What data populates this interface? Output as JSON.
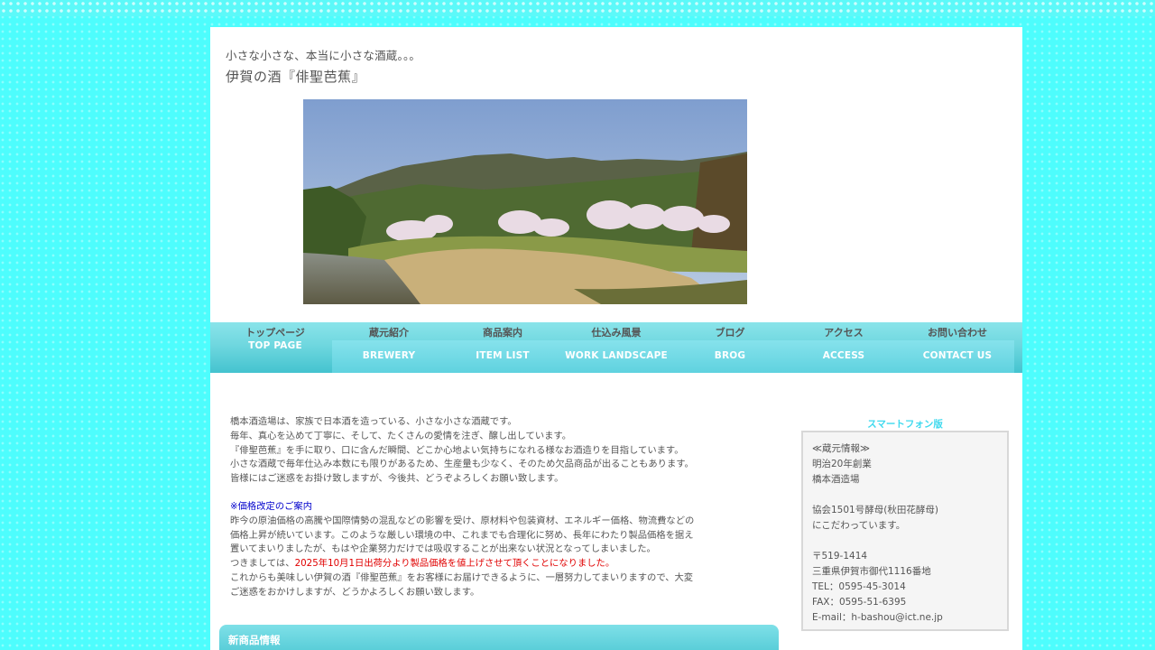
{
  "header": {
    "tagline": "小さな小さな、本当に小さな酒蔵。。。",
    "title": "伊賀の酒『俳聖芭蕉』"
  },
  "nav": {
    "top_jp": "トップページ",
    "top_en": "TOP PAGE",
    "items": [
      {
        "jp": "蔵元紹介",
        "en": "BREWERY"
      },
      {
        "jp": "商品案内",
        "en": "ITEM LIST"
      },
      {
        "jp": "仕込み風景",
        "en": "WORK LANDSCAPE"
      },
      {
        "jp": "ブログ",
        "en": "BROG"
      },
      {
        "jp": "アクセス",
        "en": "ACCESS"
      },
      {
        "jp": "お問い合わせ",
        "en": "CONTACT US"
      }
    ]
  },
  "intro": {
    "lines": [
      "橋本酒造場は、家族で日本酒を造っている、小さな小さな酒蔵です。",
      "毎年、真心を込めて丁寧に、そして、たくさんの愛情を注ぎ、醸し出しています。",
      "『俳聖芭蕉』を手に取り、口に含んだ瞬間、どこか心地よい気持ちになれる様なお酒造りを目指しています。",
      "小さな酒蔵で毎年仕込み本数にも限りがあるため、生産量も少なく、そのため欠品商品が出ることもあります。",
      "皆様にはご迷惑をお掛け致しますが、今後共、どうぞよろしくお願い致します。"
    ]
  },
  "notice": {
    "heading": "※価格改定のご案内",
    "line1": "昨今の原油価格の高騰や国際情勢の混乱などの影響を受け、原材料や包装資材、エネルギー価格、物流費などの",
    "line2": "価格上昇が続いています。このような厳しい環境の中、これまでも合理化に努め、長年にわたり製品価格を据え",
    "line3": "置いてまいりましたが、もはや企業努力だけでは吸収することが出来ない状況となってしまいました。",
    "line4_prefix": "つきましては、",
    "line4_red": "2025年10月1日出荷分より製品価格を値上げさせて頂くことになりました。",
    "line5": "これからも美味しい伊賀の酒『俳聖芭蕉』をお客様にお届けできるように、一層努力してまいりますので、大変",
    "line6": "ご迷惑をおかけしますが、どうかよろしくお願い致します。"
  },
  "new_items": {
    "heading": "新商品情報"
  },
  "sidebar": {
    "smartphone_link": "スマートフォン版",
    "info": {
      "heading": "≪蔵元情報≫",
      "founded": "明治20年創業",
      "name": "橋本酒造場",
      "yeast1": "協会1501号酵母(秋田花酵母)",
      "yeast2": "にこだわっています。",
      "postal": "〒519-1414",
      "address": "三重県伊賀市御代1116番地",
      "tel": "TEL：0595-45-3014",
      "fax": "FAX：0595-51-6395",
      "email": "E-mail：h-bashou@ict.ne.jp"
    }
  },
  "colors": {
    "background": "#4dfdfd",
    "nav_accent": "#5fd2df",
    "notice_blue": "#0000cc",
    "notice_red": "#e00000",
    "smartphone_link": "#3fd9ee"
  }
}
